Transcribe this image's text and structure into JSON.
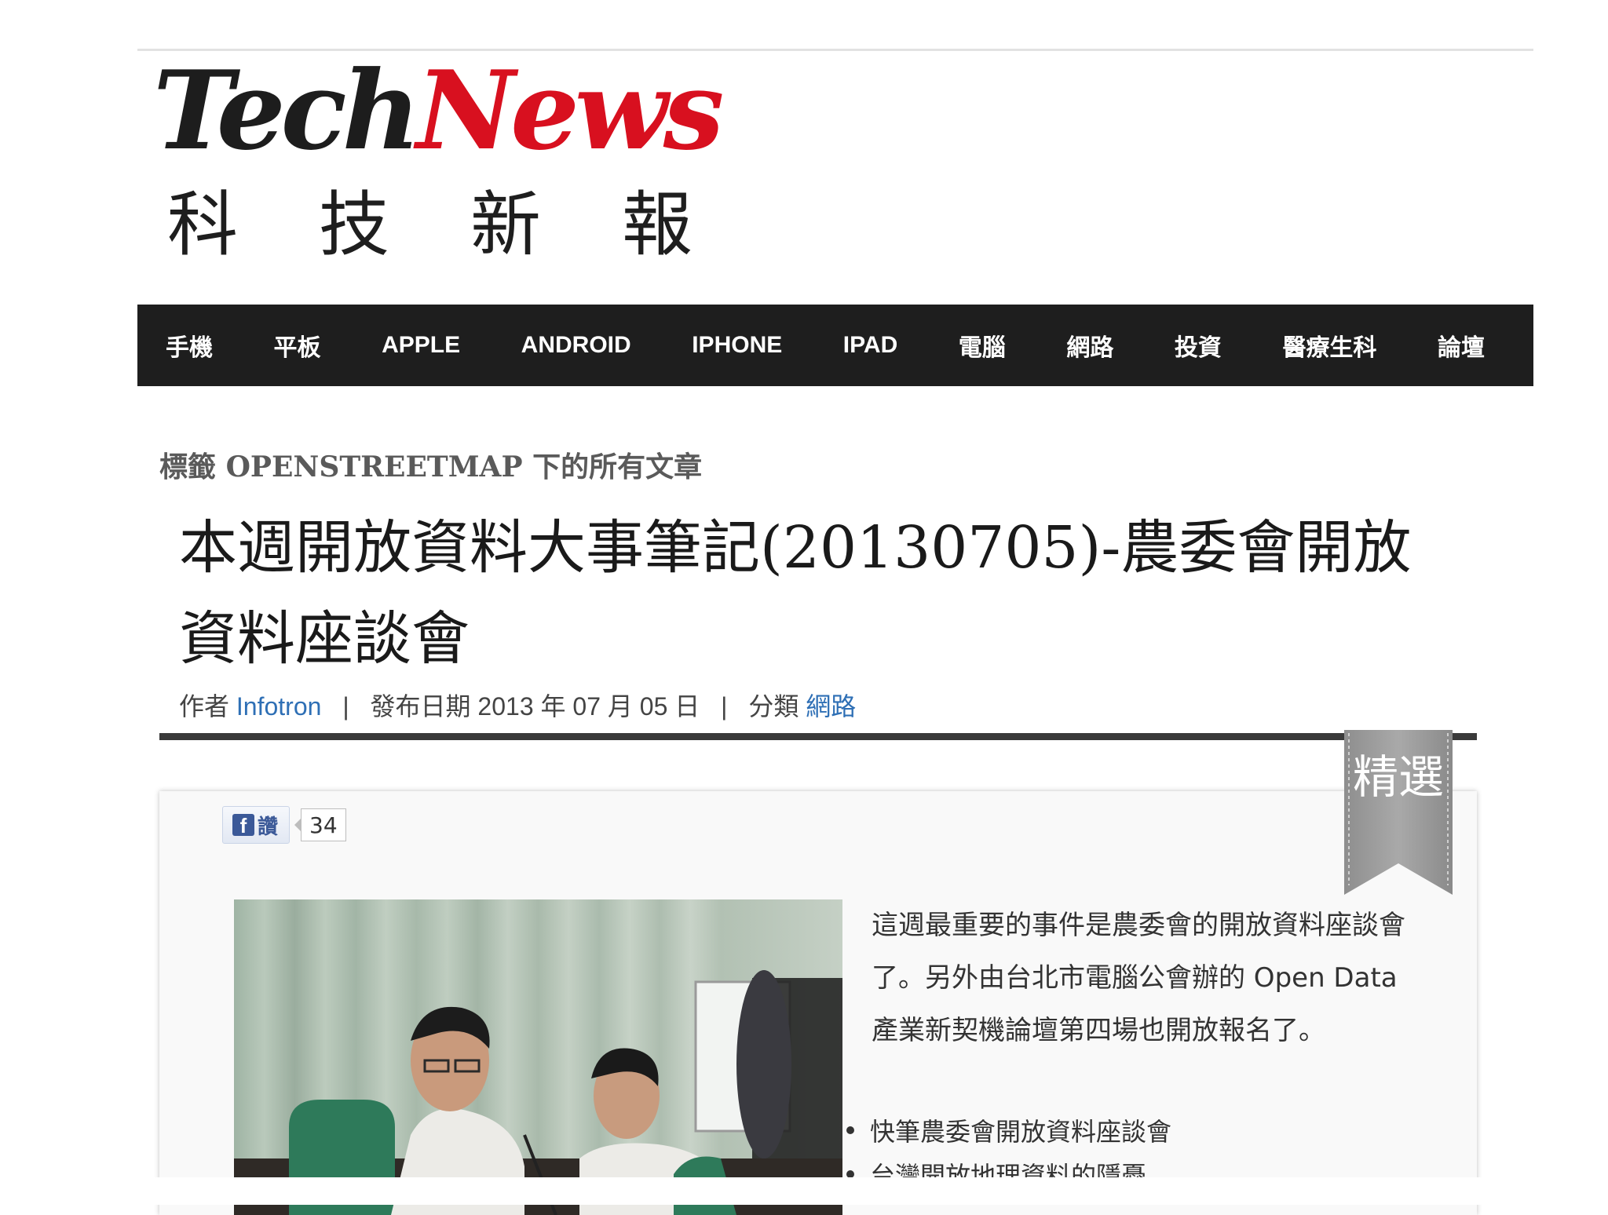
{
  "site": {
    "logo_part1": "Tech",
    "logo_part2": "News",
    "logo_sub": "科技新報",
    "brand_red": "#d8101f"
  },
  "nav": {
    "items": [
      "手機",
      "平板",
      "APPLE",
      "ANDROID",
      "IPHONE",
      "IPAD",
      "電腦",
      "網路",
      "投資",
      "醫療生科",
      "論壇"
    ]
  },
  "tag_heading": {
    "prefix": "標籤",
    "tag": "OPENSTREETMAP",
    "suffix": "下的所有文章"
  },
  "article": {
    "title": "本週開放資料大事筆記(20130705)-農委會開放資料座談會",
    "meta": {
      "author_label": "作者",
      "author": "Infotron",
      "date_label": "發布日期",
      "date": "2013 年 07 月 05 日",
      "category_label": "分類",
      "category": "網路"
    },
    "ribbon": "精選",
    "fb_like_label": "讚",
    "fb_like_count": "34",
    "intro": "這週最重要的事件是農委會的開放資料座談會了。另外由台北市電腦公會辦的 Open Data 產業新契機論壇第四場也開放報名了。",
    "bullets": [
      "快筆農委會開放資料座談會",
      "台灣開放地理資料的隱憂"
    ]
  }
}
